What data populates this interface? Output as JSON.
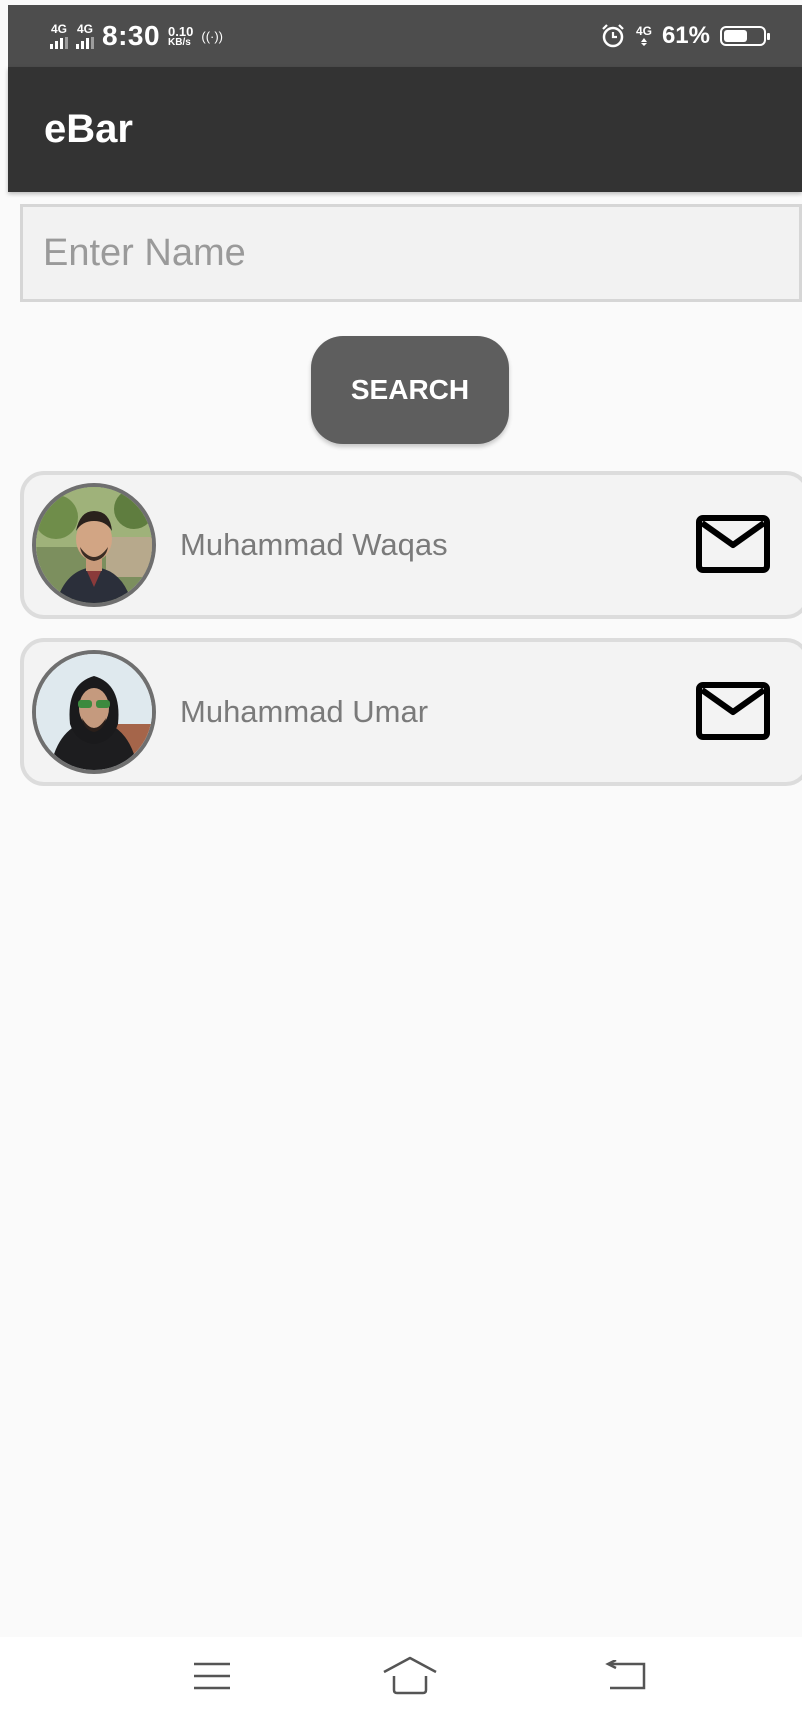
{
  "status_bar": {
    "sig1_label": "4G",
    "sig2_label": "4G",
    "time": "8:30",
    "speed_value": "0.10",
    "speed_unit": "KB/s",
    "hotspot_label": "((·))",
    "net_label": "4G",
    "battery_percent": "61%",
    "battery_level": 0.61
  },
  "app_bar": {
    "title": "eBar"
  },
  "search": {
    "placeholder": "Enter Name",
    "value": "",
    "button_label": "SEARCH"
  },
  "contacts": [
    {
      "name": "Muhammad Waqas",
      "action_icon": "mail-icon"
    },
    {
      "name": "Muhammad Umar",
      "action_icon": "mail-icon"
    }
  ],
  "colors": {
    "status_bar_bg": "#4d4d4d",
    "app_bar_bg": "#333333",
    "button_bg": "#5e5e5e",
    "card_bg": "#f3f3f3",
    "card_border": "#dcdcdc",
    "page_bg": "#fafafa"
  },
  "nav_bar": {
    "icons": [
      "menu-icon",
      "home-icon",
      "back-icon"
    ]
  }
}
